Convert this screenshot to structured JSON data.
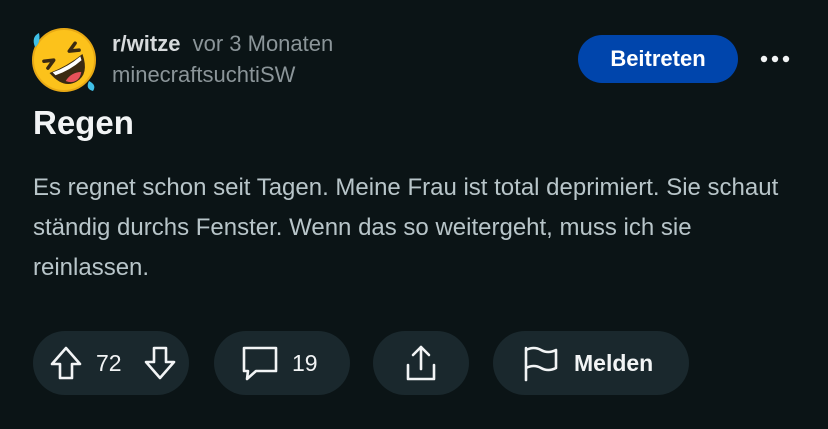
{
  "post": {
    "subreddit": "r/witze",
    "time_ago": "vor 3 Monaten",
    "author": "minecraftsuchtiSW",
    "join_label": "Beitreten",
    "title": "Regen",
    "body": "Es regnet schon seit Tagen. Meine Frau ist total deprimiert. Sie schaut ständig durchs Fenster. Wenn das so weitergeht, muss ich sie reinlassen."
  },
  "actions": {
    "vote_count": "72",
    "comment_count": "19",
    "report_label": "Melden"
  },
  "icons": {
    "avatar": "rolling-on-floor-laughing-emoji",
    "more": "more-horizontal-icon",
    "upvote": "arrow-up-icon",
    "downvote": "arrow-down-icon",
    "comment": "speech-bubble-icon",
    "share": "share-upload-icon",
    "report": "flag-icon"
  },
  "colors": {
    "background": "#0b1416",
    "join_button": "#0045ac",
    "pill_background": "#1a282d",
    "muted_text": "#8b9599",
    "body_text": "#b8c5c9",
    "emoji_yellow": "#fcc21b"
  }
}
